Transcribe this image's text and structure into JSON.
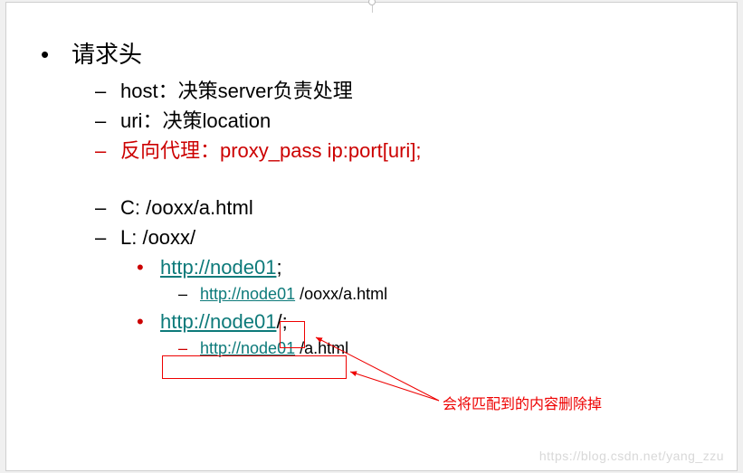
{
  "heading": "请求头",
  "items": {
    "host": "host：决策server负责处理",
    "uri": "uri：决策location",
    "proxy": "反向代理：proxy_pass  ip:port[uri];",
    "c_line": "C:    /ooxx/a.html",
    "l_line": "L:   /ooxx/",
    "link1": "http://node01",
    "link1_suffix": ";",
    "sub1_link": "http://node01",
    "sub1_suffix": " /ooxx/a.html",
    "link2": "http://node01",
    "link2_suffix": "/;",
    "sub2_link": "http://node01",
    "sub2_suffix": " /a.html"
  },
  "annotation": "会将匹配到的内容删除掉",
  "watermark": "https://blog.csdn.net/yang_zzu"
}
